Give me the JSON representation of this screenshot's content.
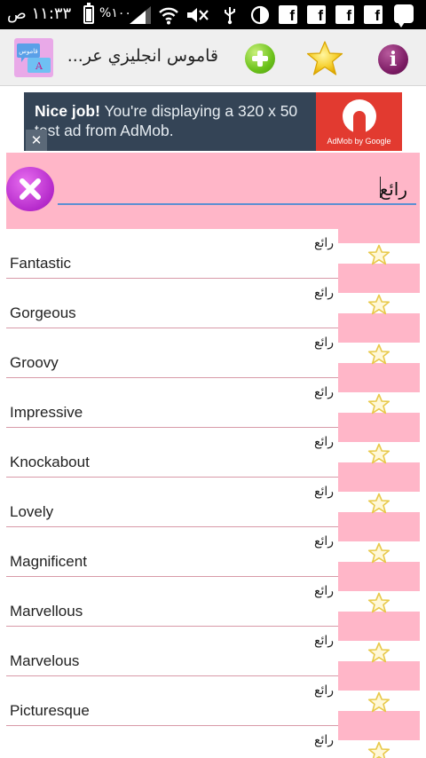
{
  "status_bar": {
    "time": "١١:٣٣ ص",
    "battery": "%١٠٠"
  },
  "action_bar": {
    "app_title": "قاموس انجليزي عر...",
    "logo_text_top": "قاموس",
    "logo_text_bottom": "A",
    "info_label": "i",
    "icons": [
      "app-logo-icon",
      "add-icon",
      "favorites-star-icon",
      "info-icon"
    ]
  },
  "ad": {
    "headline": "Nice job!",
    "body": " You're displaying a 320 x 50 test ad from AdMob.",
    "brand": "AdMob by Google",
    "close_label": "✕"
  },
  "search": {
    "value": "رائع",
    "clear_icon": "close-x-icon"
  },
  "results": [
    {
      "english": "Fantastic",
      "arabic": "رائع"
    },
    {
      "english": "Gorgeous",
      "arabic": "رائع"
    },
    {
      "english": "Groovy",
      "arabic": "رائع"
    },
    {
      "english": "Impressive",
      "arabic": "رائع"
    },
    {
      "english": "Knockabout",
      "arabic": "رائع"
    },
    {
      "english": "Lovely",
      "arabic": "رائع"
    },
    {
      "english": "Magnificent",
      "arabic": "رائع"
    },
    {
      "english": "Marvellous",
      "arabic": "رائع"
    },
    {
      "english": "Marvelous",
      "arabic": "رائع"
    },
    {
      "english": "Picturesque",
      "arabic": "رائع"
    },
    {
      "english": "",
      "arabic": "رائع"
    }
  ],
  "colors": {
    "accent_pink": "#ffb6c8",
    "star_outline": "#e8c94a",
    "underline_blue": "#5c8fd2"
  }
}
